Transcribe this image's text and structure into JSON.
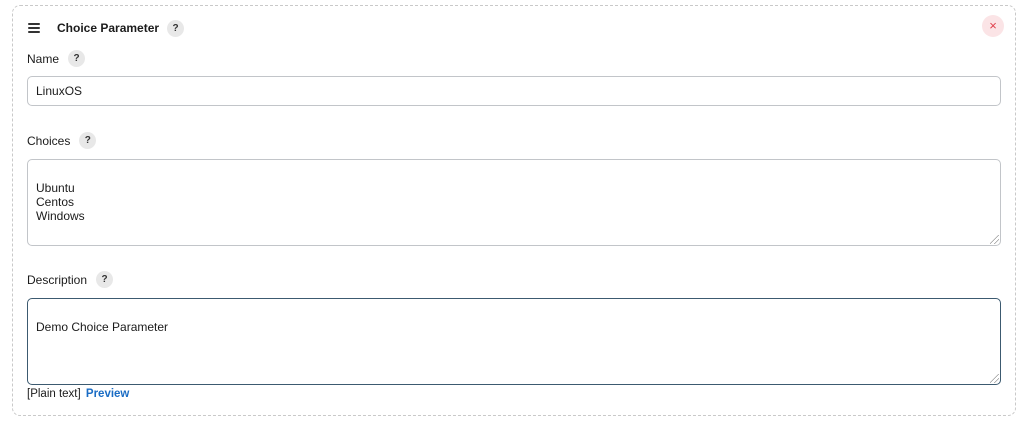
{
  "header": {
    "title": "Choice Parameter",
    "help": "?",
    "close": "×"
  },
  "name": {
    "label": "Name",
    "help": "?",
    "value": "LinuxOS"
  },
  "choices": {
    "label": "Choices",
    "help": "?",
    "value": "Ubuntu\nCentos\nWindows"
  },
  "description": {
    "label": "Description",
    "help": "?",
    "value": "Demo Choice Parameter"
  },
  "footer": {
    "plain_text": "[Plain text]",
    "preview": "Preview"
  },
  "colors": {
    "close_bg": "#fbe4e6",
    "close_fg": "#e0404c",
    "link": "#1a6cc4",
    "focus_border": "#3c5a70"
  },
  "icons": {
    "drag": "hamburger-drag-handle",
    "close": "close-x"
  }
}
